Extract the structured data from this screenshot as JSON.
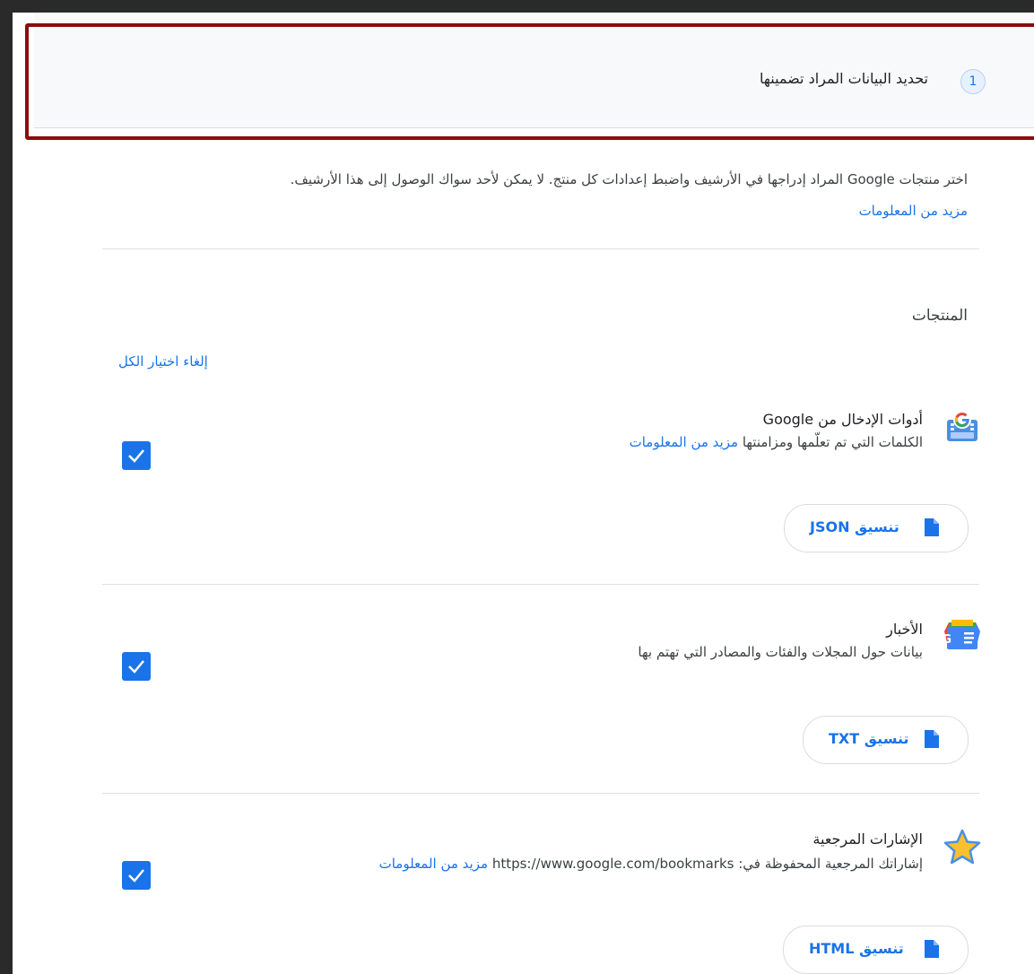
{
  "step": {
    "number": "1",
    "title": "تحديد البيانات المراد تضمينها"
  },
  "intro": {
    "description": "اختر منتجات Google المراد إدراجها في الأرشيف واضبط إعدادات كل منتج. لا يمكن لأحد سواك الوصول إلى هذا الأرشيف.",
    "more_link": "مزيد من المعلومات"
  },
  "products_section": {
    "label": "المنتجات",
    "deselect_all": "إلغاء اختيار الكل"
  },
  "products": [
    {
      "name": "أدوات الإدخال من Google",
      "description": "الكلمات التي تم تعلّمها ومزامنتها",
      "link": "مزيد من المعلومات",
      "format": "تنسيق JSON",
      "checked": true,
      "icon": "gboard-icon"
    },
    {
      "name": "الأخبار",
      "description": "بيانات حول المجلات والفئات والمصادر التي تهتم بها",
      "format": "تنسيق TXT",
      "checked": true,
      "icon": "google-news-icon"
    },
    {
      "name": "الإشارات المرجعية",
      "description": "إشاراتك المرجعية المحفوظة في: https://www.google.com/bookmarks",
      "link": "مزيد من المعلومات",
      "format": "تنسيق HTML",
      "checked": true,
      "icon": "star-icon"
    }
  ],
  "colors": {
    "accent": "#1a73e8",
    "highlight_frame": "#8b0d0d",
    "header_bg": "#f8f9fa"
  }
}
